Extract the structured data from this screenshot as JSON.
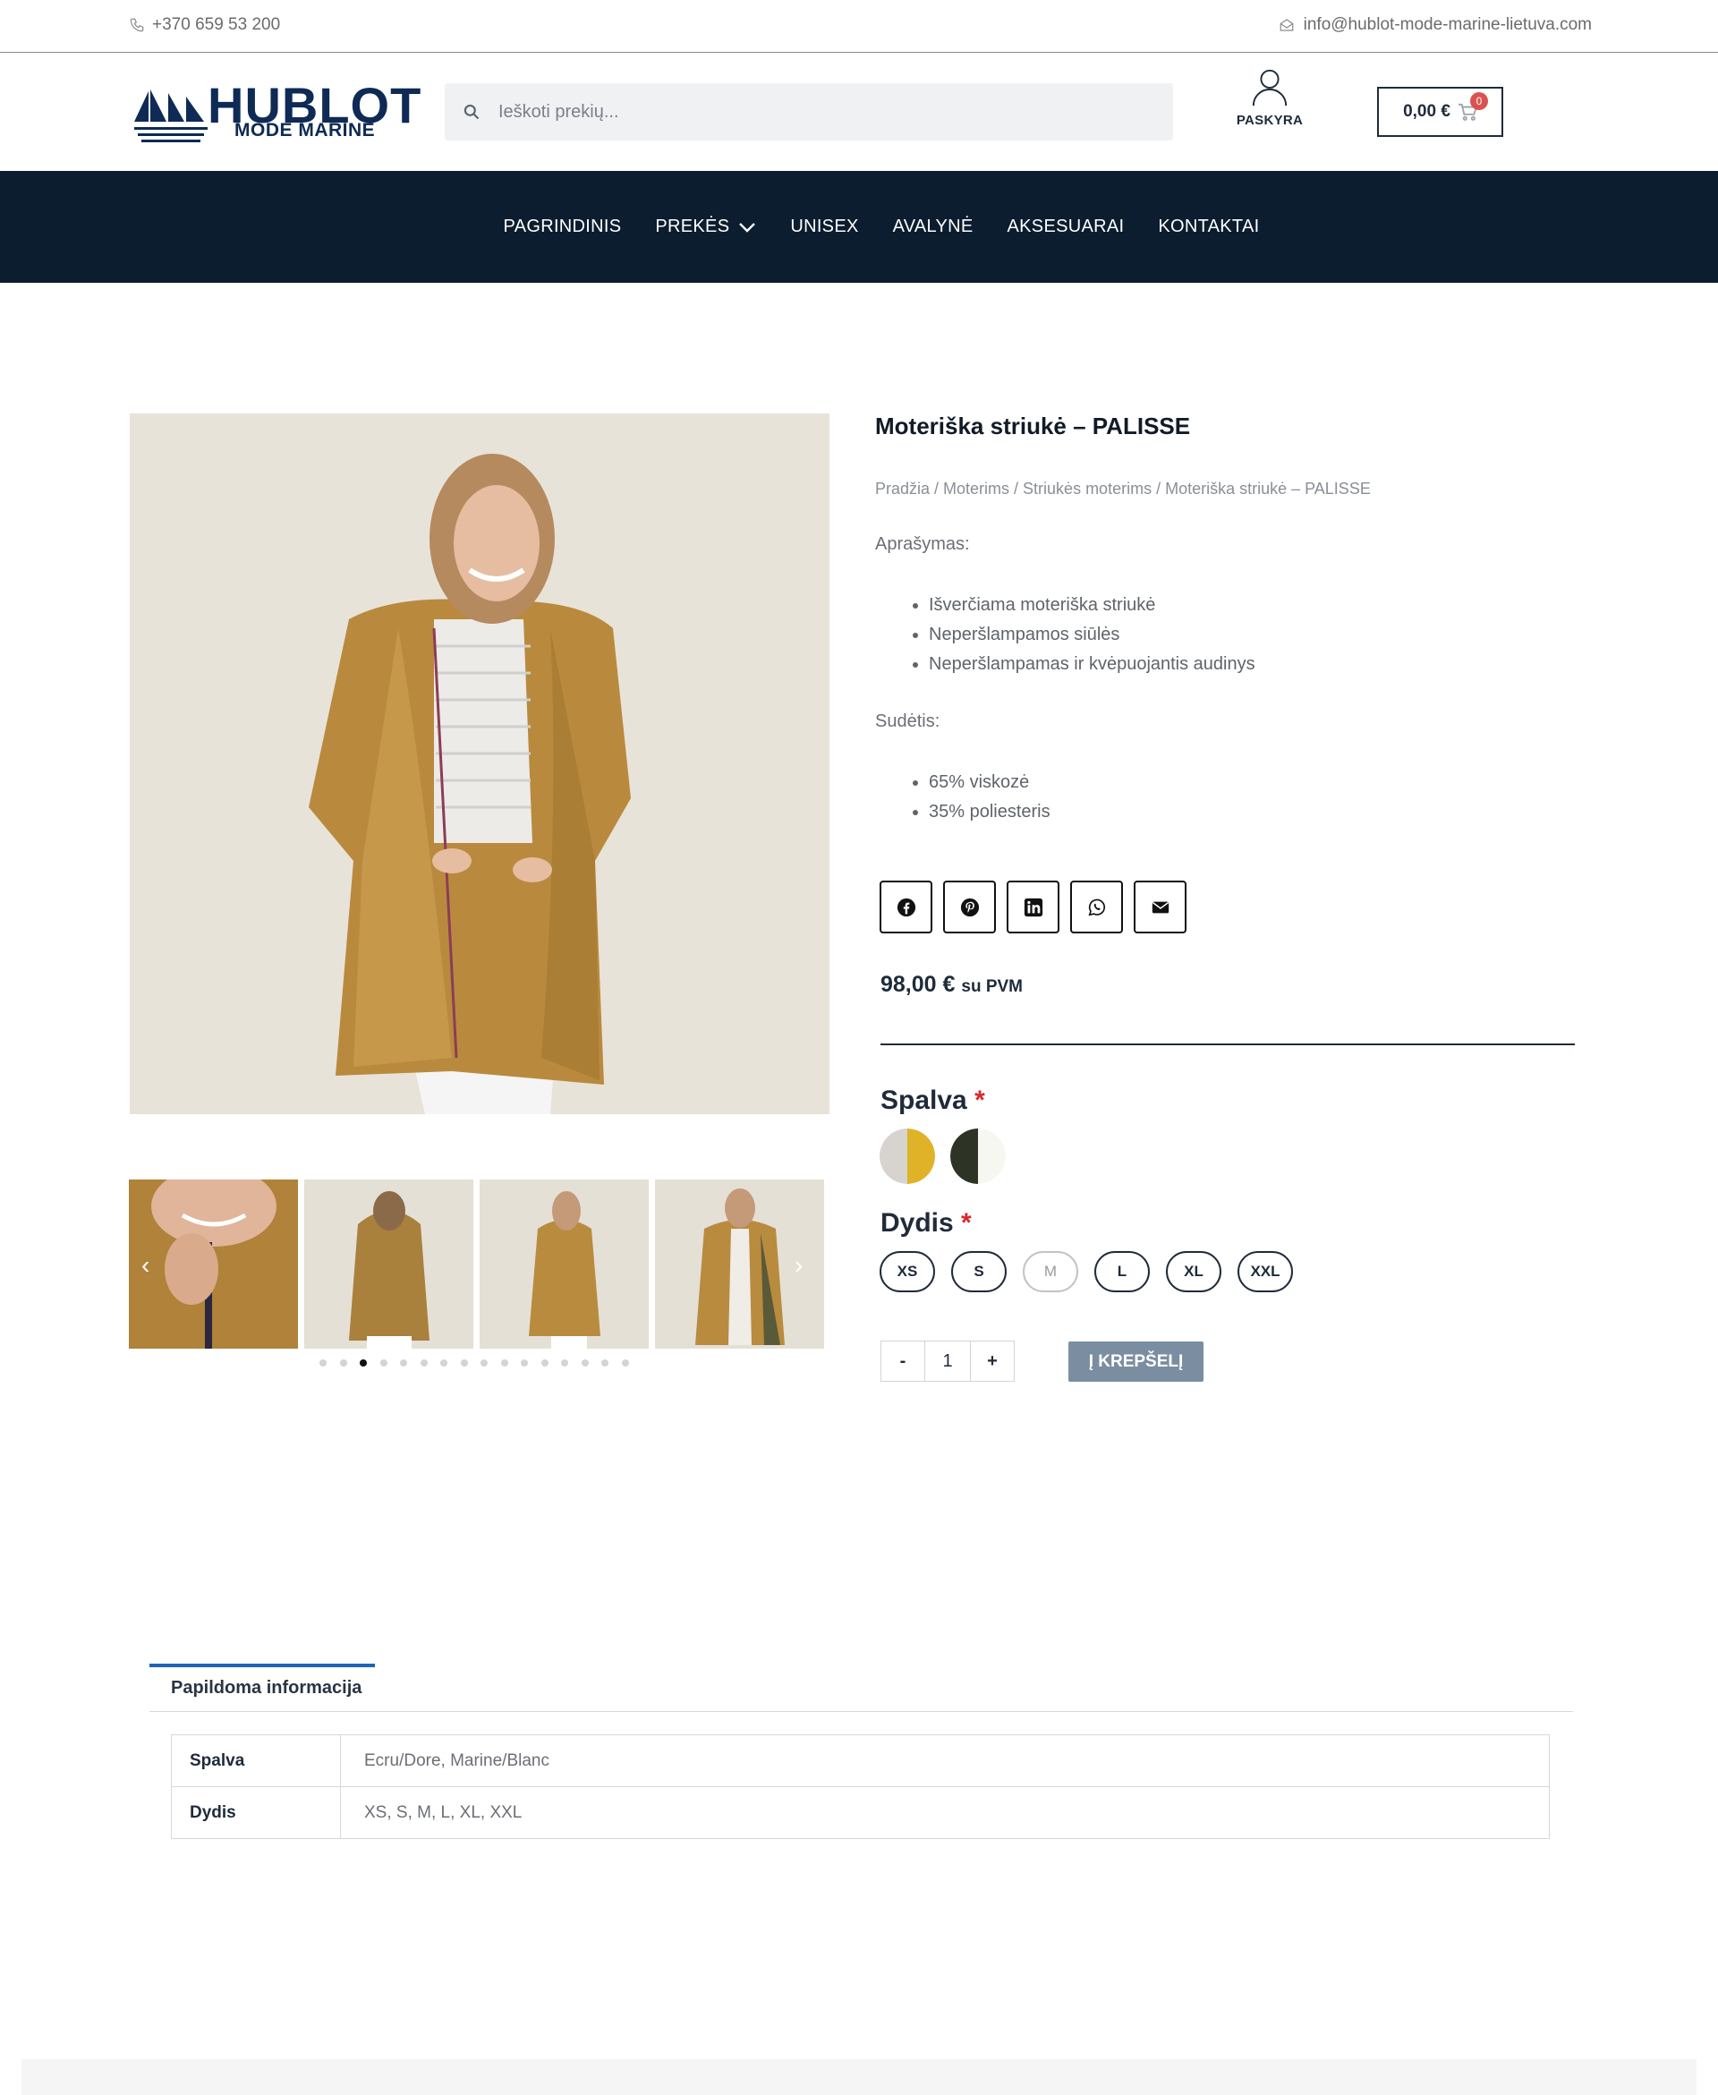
{
  "topbar": {
    "phone": "+370 659 53 200",
    "email": "info@hublot-mode-marine-lietuva.com",
    "phone_icon": "phone-icon",
    "email_icon": "envelope-open-icon"
  },
  "header": {
    "logo": {
      "brand": "HUBLOT",
      "sub": "MODE MARINE"
    },
    "search": {
      "placeholder": "Ieškoti prekių..."
    },
    "account_label": "PASKYRA",
    "cart": {
      "amount": "0,00 €",
      "count": "0"
    }
  },
  "nav": {
    "items": [
      {
        "label": "PAGRINDINIS"
      },
      {
        "label": "PREKĖS"
      },
      {
        "label": "UNISEX"
      },
      {
        "label": "AVALYNĖ"
      },
      {
        "label": "AKSESUARAI"
      },
      {
        "label": "KONTAKTAI"
      }
    ]
  },
  "product": {
    "title": "Moteriška striukė – PALISSE",
    "breadcrumb": "Pradžia / Moterims / Striukės moterims / Moteriška striukė – PALISSE",
    "description_heading": "Aprašymas:",
    "description_items": [
      "Išverčiama moteriška striukė",
      "Neperšlampamos siūlės",
      "Neperšlampamas ir kvėpuojantis audinys"
    ],
    "composition_heading": "Sudėtis:",
    "composition_items": [
      "65% viskozė",
      "35% poliesteris"
    ],
    "share_icons": [
      "facebook-icon",
      "pinterest-icon",
      "linkedin-icon",
      "whatsapp-icon",
      "envelope-icon"
    ],
    "price": "98,00 €",
    "price_suffix": "su PVM",
    "color_label": "Spalva",
    "color_swatches": [
      {
        "colors": [
          "#d7d4cf",
          "#e0b227"
        ]
      },
      {
        "colors": [
          "#2d3325",
          "#f7f7f2"
        ]
      }
    ],
    "size_label": "Dydis",
    "required_mark": "*",
    "sizes": [
      "XS",
      "S",
      "M",
      "L",
      "XL",
      "XXL"
    ],
    "unavailable_size": "M",
    "quantity": {
      "minus": "-",
      "value": "1",
      "plus": "+"
    },
    "add_to_cart": "Į KREPŠELĮ",
    "gallery": {
      "slide_count": 16,
      "active_slide": 3
    }
  },
  "tabs": {
    "active": "Papildoma informacija",
    "table": [
      {
        "key": "Spalva",
        "value": "Ecru/Dore, Marine/Blanc"
      },
      {
        "key": "Dydis",
        "value": "XS, S, M, L, XL, XXL"
      }
    ]
  },
  "colors": {
    "nav_bg": "#0c1d30",
    "brand": "#0e2a55",
    "button": "#7b8ea1",
    "tab_accent": "#1e63b7",
    "required": "#d9262b"
  }
}
